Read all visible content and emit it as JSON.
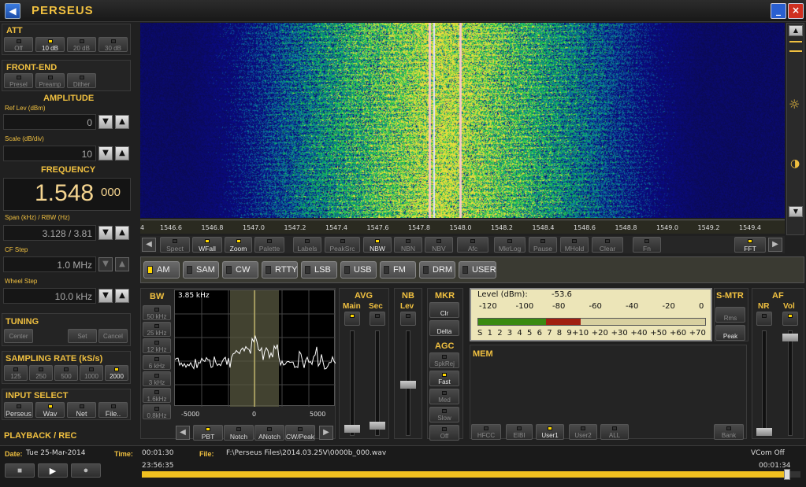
{
  "app": {
    "title": "PERSEUS",
    "icon": "back-arrow-icon"
  },
  "att": {
    "title": "ATT",
    "buttons": [
      {
        "label": "Off",
        "on": false
      },
      {
        "label": "10 dB",
        "on": true
      },
      {
        "label": "20 dB",
        "on": false
      },
      {
        "label": "30 dB",
        "on": false
      }
    ]
  },
  "frontend": {
    "title": "FRONT-END",
    "buttons": [
      {
        "label": "Presel",
        "on": false
      },
      {
        "label": "Preamp",
        "on": false
      },
      {
        "label": "Dither",
        "on": false
      }
    ]
  },
  "amplitude": {
    "title": "AMPLITUDE",
    "reflev_label": "Ref Lev (dBm)",
    "reflev": "0",
    "scale_label": "Scale (dB/div)",
    "scale": "10"
  },
  "frequency": {
    "title": "FREQUENCY",
    "main": "1.548",
    "sub": "000",
    "span_label": "Span (kHz) / RBW (Hz)",
    "span": "3.128 / 3.81",
    "cfstep_label": "CF Step",
    "cfstep": "1.0 MHz",
    "wheel_label": "Wheel Step",
    "wheel": "10.0 kHz"
  },
  "tuning": {
    "title": "TUNING",
    "buttons": [
      "Center",
      "Set",
      "Cancel"
    ]
  },
  "sampling": {
    "title": "SAMPLING RATE (kS/s)",
    "buttons": [
      {
        "label": "125",
        "on": false
      },
      {
        "label": "250",
        "on": false
      },
      {
        "label": "500",
        "on": false
      },
      {
        "label": "1000",
        "on": false
      },
      {
        "label": "2000",
        "on": true
      }
    ]
  },
  "input": {
    "title": "INPUT SELECT",
    "buttons": [
      {
        "label": "Perseus",
        "on": false
      },
      {
        "label": "Wav",
        "on": true
      },
      {
        "label": "Net",
        "on": false
      },
      {
        "label": "File..",
        "on": false
      }
    ]
  },
  "playback": {
    "title": "PLAYBACK / REC",
    "date_label": "Date:",
    "date": "Tue 25-Mar-2014",
    "time_label": "Time:",
    "time": "00:01:30",
    "file_label": "File:",
    "file": "F:\\Perseus Files\\2014.03.25V\\0000b_000.wav",
    "vcom": "VCom Off",
    "start": "23:56:35",
    "end": "00:01:34",
    "progress": 0.98
  },
  "spectrum": {
    "freq_labels": [
      "1546.6",
      "1546.8",
      "1547.0",
      "1547.2",
      "1547.4",
      "1547.6",
      "1547.8",
      "1548.0",
      "1548.2",
      "1548.4",
      "1548.6",
      "1548.8",
      "1549.0",
      "1549.2",
      "1549.4"
    ],
    "edge_left": "4"
  },
  "toolbar": [
    {
      "label": "Spect",
      "on": false
    },
    {
      "label": "WFall",
      "on": true
    },
    {
      "label": "Zoom",
      "on": true
    },
    {
      "label": "Palette",
      "on": false
    },
    {
      "label": "Labels",
      "on": false
    },
    {
      "label": "PeakSrc",
      "on": false
    },
    {
      "label": "NBW",
      "on": true
    },
    {
      "label": "NBN",
      "on": false
    },
    {
      "label": "NBV",
      "on": false
    },
    {
      "label": "Afc",
      "on": false
    },
    {
      "label": "MkrLog",
      "on": false
    },
    {
      "label": "Pause",
      "on": false
    },
    {
      "label": "MHold",
      "on": false
    },
    {
      "label": "Clear",
      "on": false
    },
    {
      "label": "Fn",
      "on": false
    },
    {
      "label": "FFT",
      "on": true
    }
  ],
  "modes": [
    {
      "label": "AM",
      "on": true
    },
    {
      "label": "SAM",
      "on": false
    },
    {
      "label": "CW",
      "on": false
    },
    {
      "label": "RTTY",
      "on": false
    },
    {
      "label": "LSB",
      "on": false
    },
    {
      "label": "USB",
      "on": false
    },
    {
      "label": "FM",
      "on": false
    },
    {
      "label": "DRM",
      "on": false
    },
    {
      "label": "USER",
      "on": false
    }
  ],
  "bw": {
    "title": "BW",
    "buttons": [
      {
        "label": "50 kHz",
        "on": false
      },
      {
        "label": "25 kHz",
        "on": false
      },
      {
        "label": "12 kHz",
        "on": false
      },
      {
        "label": "6 kHz",
        "on": false
      },
      {
        "label": "3 kHz",
        "on": false
      },
      {
        "label": "1.6kHz",
        "on": false
      },
      {
        "label": "0.8kHz",
        "on": false
      }
    ],
    "value": "3.85 kHz",
    "axis": [
      "-5000",
      "0",
      "5000"
    ]
  },
  "filterbtns": [
    {
      "label": "PBT",
      "on": true
    },
    {
      "label": "Notch",
      "on": false
    },
    {
      "label": "ANotch",
      "on": false
    },
    {
      "label": "CW/Peak",
      "on": false
    }
  ],
  "avg": {
    "title": "AVG",
    "main": "Main",
    "sec": "Sec"
  },
  "nb": {
    "title": "NB",
    "lev": "Lev"
  },
  "mkr": {
    "title": "MKR",
    "buttons": [
      "Clr",
      "Delta"
    ]
  },
  "agc": {
    "title": "AGC",
    "buttons": [
      {
        "label": "SpkRej",
        "on": false
      },
      {
        "label": "Fast",
        "on": true
      },
      {
        "label": "Med",
        "on": false
      },
      {
        "label": "Slow",
        "on": false
      },
      {
        "label": "Off",
        "on": false
      }
    ]
  },
  "meter": {
    "level_label": "Level (dBm):",
    "level": "-53.6",
    "top_scale": [
      "-120",
      "-100",
      "-80",
      "-60",
      "-40",
      "-20",
      "0"
    ],
    "bottom_scale": [
      "S",
      "1",
      "2",
      "3",
      "4",
      "5",
      "6",
      "7",
      "8",
      "9",
      "+10",
      "+20",
      "+30",
      "+40",
      "+50",
      "+60",
      "+70"
    ],
    "level_fraction": 0.45
  },
  "smtr": {
    "title": "S-MTR",
    "buttons": [
      {
        "label": "Rms",
        "on": false
      },
      {
        "label": "Peak",
        "on": true
      }
    ]
  },
  "af": {
    "title": "AF",
    "nr": "NR",
    "vol": "Vol"
  },
  "mem": {
    "title": "MEM",
    "buttons": [
      {
        "label": "HFCC",
        "on": false
      },
      {
        "label": "EIBI",
        "on": false
      },
      {
        "label": "User1",
        "on": true
      },
      {
        "label": "User2",
        "on": false
      },
      {
        "label": "ALL",
        "on": false
      },
      {
        "label": "Bank",
        "on": false
      }
    ]
  },
  "colors": {
    "accent": "#f0c040",
    "led": "#ffd800",
    "freq": "#f5d590"
  }
}
